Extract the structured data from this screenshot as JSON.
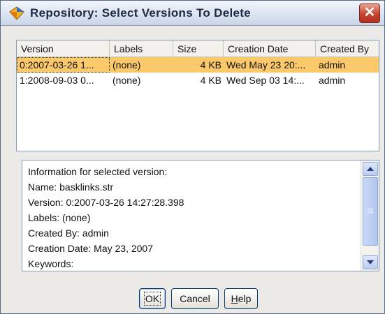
{
  "window": {
    "title": "Repository: Select Versions To Delete",
    "close_glyph": "✕"
  },
  "table": {
    "headers": [
      "Version",
      "Labels",
      "Size",
      "Creation Date",
      "Created By"
    ],
    "rows": [
      {
        "version": "0:2007-03-26 1...",
        "labels": "(none)",
        "size": "4 KB",
        "created": "Wed May 23 20:...",
        "by": "admin",
        "selected": true
      },
      {
        "version": "1:2008-09-03 0...",
        "labels": "(none)",
        "size": "4 KB",
        "created": "Wed Sep 03 14:...",
        "by": "admin",
        "selected": false
      }
    ]
  },
  "info": {
    "lines": [
      "Information for selected version:",
      "Name: basklinks.str",
      "Version: 0:2007-03-26 14:27:28.398",
      "Labels: (none)",
      "Created By: admin",
      "Creation Date: May 23, 2007",
      "Keywords:"
    ]
  },
  "buttons": {
    "ok": "OK",
    "cancel": "Cancel",
    "help_first": "H",
    "help_rest": "elp"
  },
  "colors": {
    "selection": "#fcc96a",
    "accent_border": "#003c74",
    "close": "#c8432f"
  },
  "icons": {
    "app": "repository-diamond-icon",
    "close": "close-icon",
    "scroll_up": "scroll-up-arrow-icon",
    "scroll_down": "scroll-down-arrow-icon"
  }
}
